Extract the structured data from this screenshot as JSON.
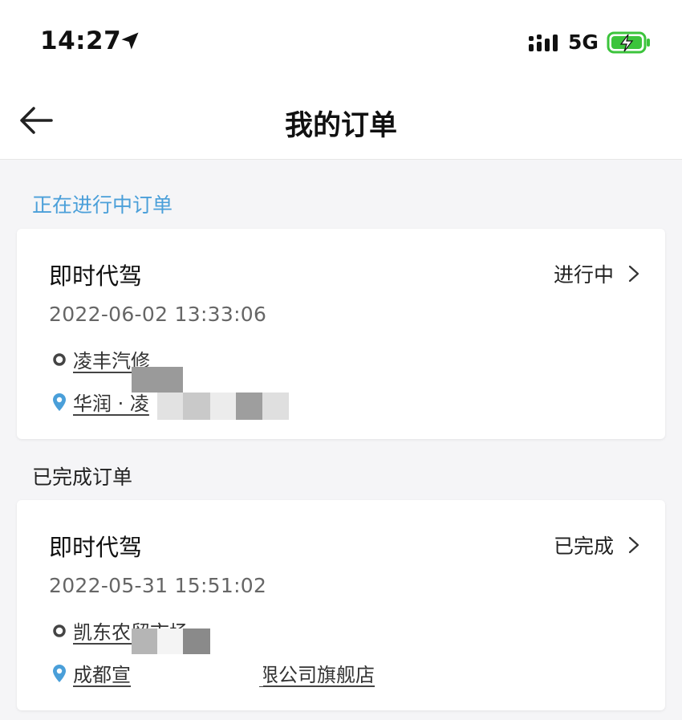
{
  "status_bar": {
    "time": "14:27",
    "network": "5G"
  },
  "nav": {
    "title": "我的订单"
  },
  "sections": {
    "ongoing_title": "正在进行中订单",
    "done_title": "已完成订单"
  },
  "orders": [
    {
      "service": "即时代驾",
      "status": "进行中",
      "time": "2022-06-02 13:33:06",
      "start": "凌丰汽修",
      "end": "华润 · 凌"
    },
    {
      "service": "即时代驾",
      "status": "已完成",
      "time": "2022-05-31 15:51:02",
      "start": "凯东农贸市场",
      "end": "成都宣",
      "end_tail": "限公司旗舰店"
    }
  ],
  "colors": {
    "accent": "#4a9fd9",
    "battery": "#3cc43c",
    "background": "#f5f5f7"
  }
}
